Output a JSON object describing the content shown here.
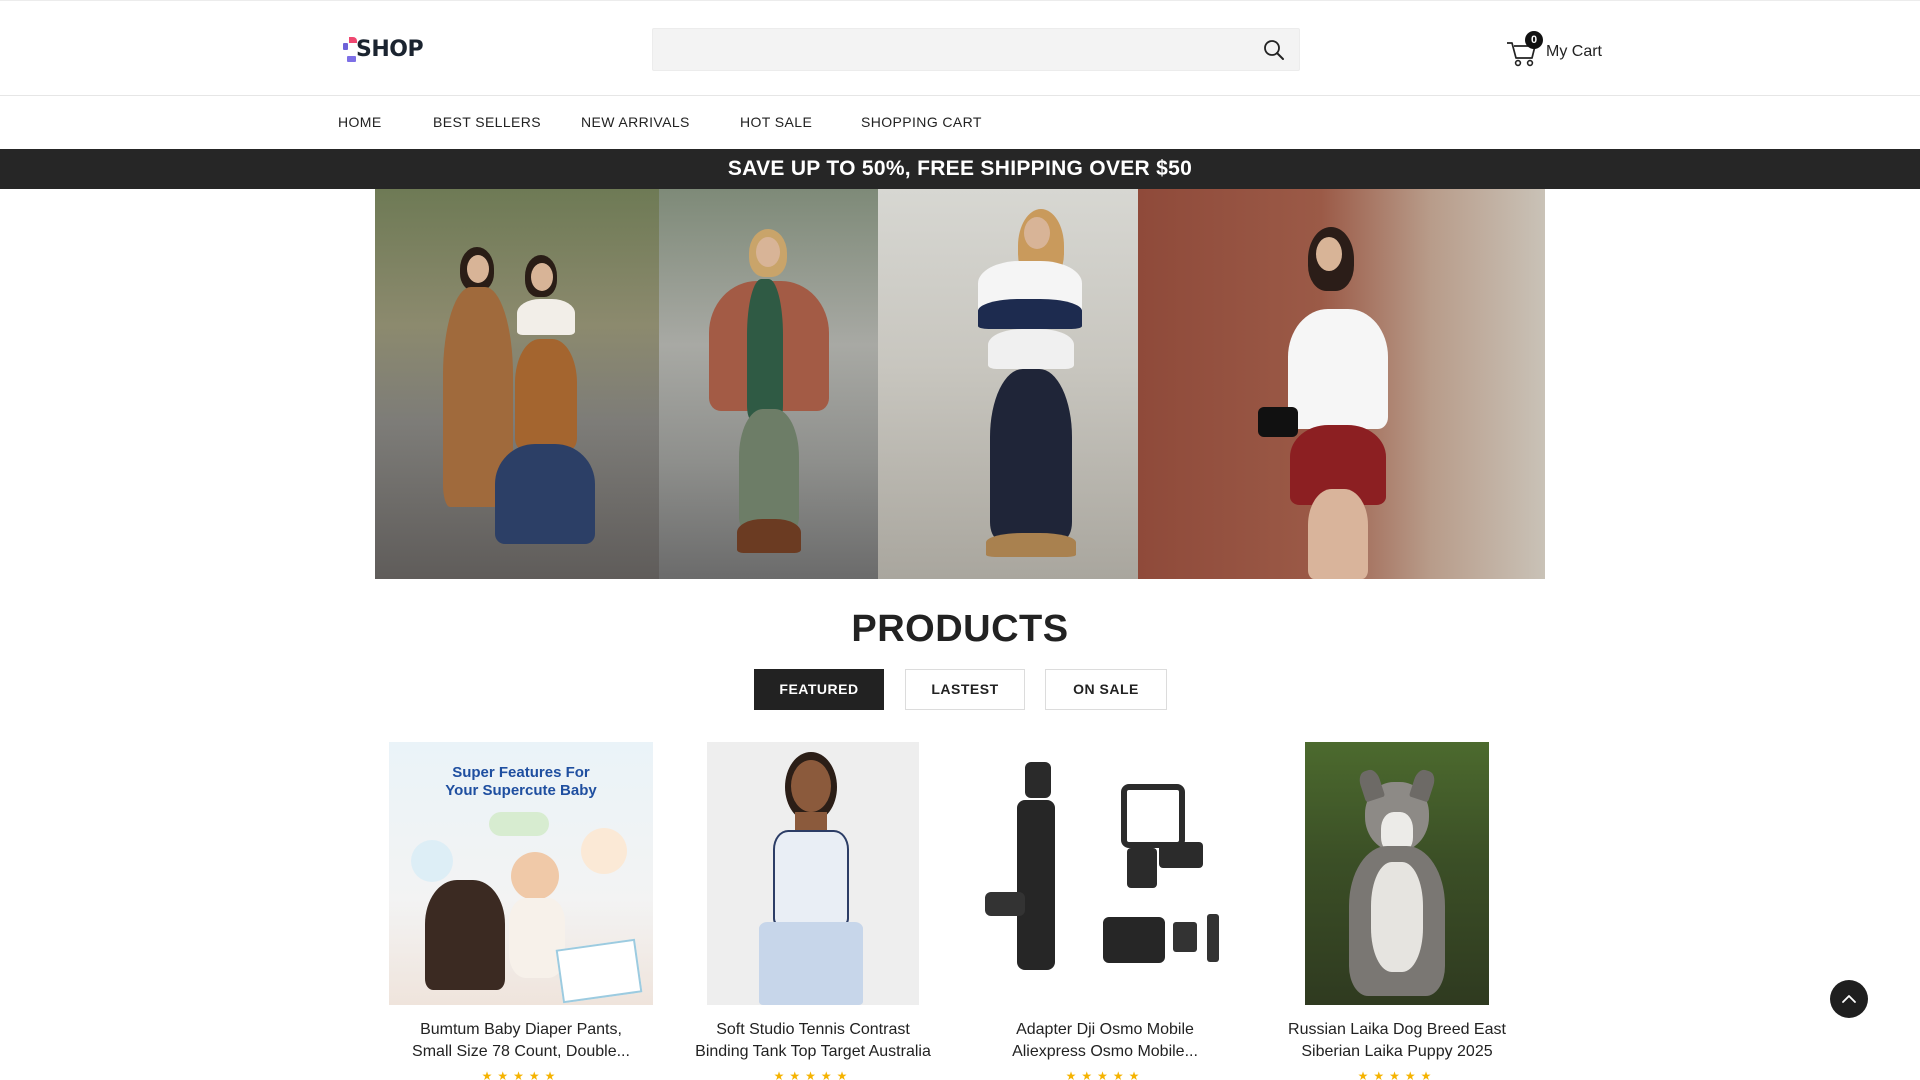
{
  "brand": {
    "logo_text": "SHOP"
  },
  "search": {
    "placeholder": ""
  },
  "cart": {
    "count": "0",
    "label": "My Cart"
  },
  "nav": {
    "items": [
      {
        "label": "HOME"
      },
      {
        "label": "BEST SELLERS"
      },
      {
        "label": "NEW ARRIVALS"
      },
      {
        "label": "HOT SALE"
      },
      {
        "label": "SHOPPING CART"
      }
    ]
  },
  "promo": {
    "text": "SAVE UP TO 50%, FREE SHIPPING OVER $50"
  },
  "products_section": {
    "title": "PRODUCTS",
    "tabs": [
      {
        "label": "FEATURED",
        "active": true
      },
      {
        "label": "LASTEST",
        "active": false
      },
      {
        "label": "ON SALE",
        "active": false
      }
    ]
  },
  "products": [
    {
      "title_line1": "Bumtum Baby Diaper Pants,",
      "title_line2": "Small Size 78 Count, Double...",
      "rating_stars": "★★★★★",
      "image_text_1": "Super Features For",
      "image_text_2": "Your Supercute Baby"
    },
    {
      "title_line1": "Soft Studio Tennis Contrast",
      "title_line2": "Binding Tank Top Target Australia",
      "rating_stars": "★★★★★"
    },
    {
      "title_line1": "Adapter Dji Osmo Mobile",
      "title_line2": "Aliexpress Osmo Mobile...",
      "rating_stars": "★★★★★"
    },
    {
      "title_line1": "Russian Laika Dog Breed East",
      "title_line2": "Siberian Laika Puppy 2025",
      "rating_stars": "★★★★★"
    }
  ],
  "colors": {
    "promo_bg": "#262626",
    "active_tab_bg": "#222222",
    "star": "#f5b301",
    "logo_accent_pink": "#ef4770",
    "logo_accent_purple": "#6f62d8"
  }
}
